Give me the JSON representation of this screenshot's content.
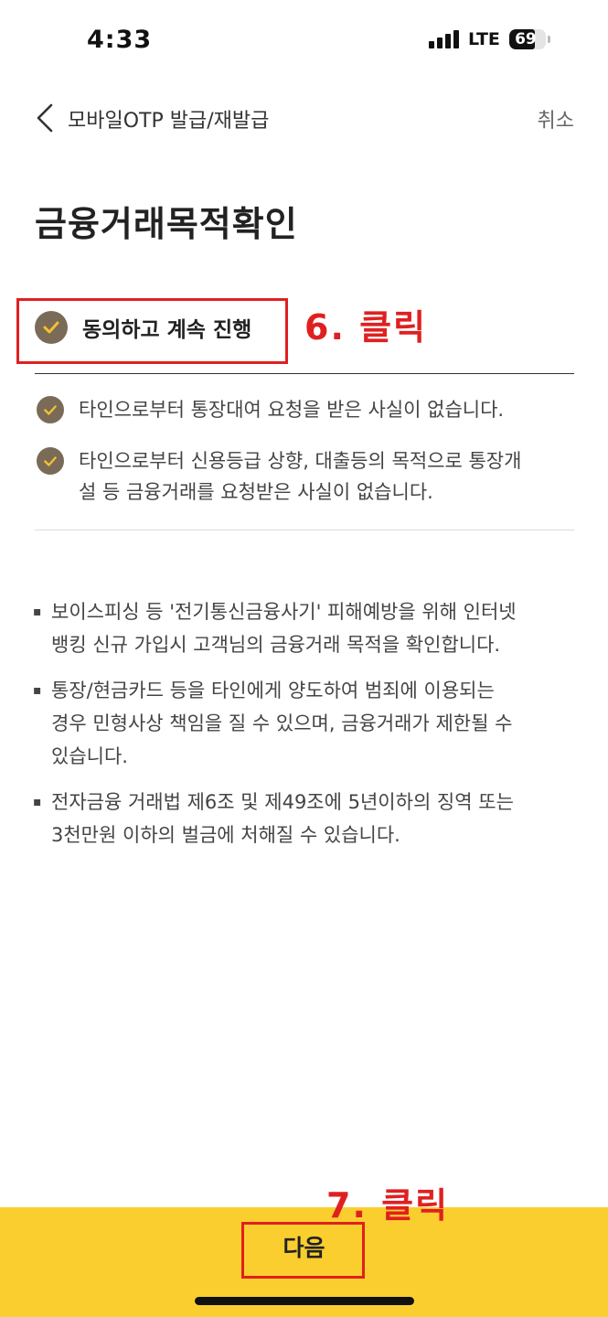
{
  "status_bar": {
    "time": "4:33",
    "network": "LTE",
    "battery": "69",
    "battery_level_percent": 69
  },
  "header": {
    "title": "모바일OTP 발급/재발급",
    "cancel_label": "취소",
    "back_icon": "chevron-left-icon"
  },
  "page_title": "금융거래목적확인",
  "agreement": {
    "all_label": "동의하고 계속 진행",
    "items": [
      {
        "text": "타인으로부터 통장대여 요청을 받은 사실이 없습니다."
      },
      {
        "line1": "타인으로부터 신용등급 상향, 대출등의 목적으로 통장개",
        "line2": "설 등 금융거래를 요청받은 사실이 없습니다."
      }
    ]
  },
  "notices": [
    {
      "line1": "보이스피싱 등 '전기통신금융사기' 피해예방을 위해 인터넷",
      "line2": "뱅킹 신규 가입시 고객님의 금융거래 목적을 확인합니다."
    },
    {
      "line1": "통장/현금카드 등을 타인에게 양도하여 범죄에 이용되는",
      "line2": "경우 민형사상 책임을 질 수 있으며, 금융거래가 제한될 수",
      "line3": "있습니다."
    },
    {
      "line1": "전자금융 거래법 제6조 및 제49조에 5년이하의 징역 또는",
      "line2": "3천만원 이하의 벌금에 처해질 수 있습니다."
    }
  ],
  "next_label": "다음",
  "annotations": {
    "step6": "6. 클릭",
    "step7": "7. 클릭"
  },
  "colors": {
    "accent_yellow": "#fbce2f",
    "check_brown": "#7a6a58",
    "check_mark": "#f2c12e",
    "annotation_red": "#e02020"
  }
}
